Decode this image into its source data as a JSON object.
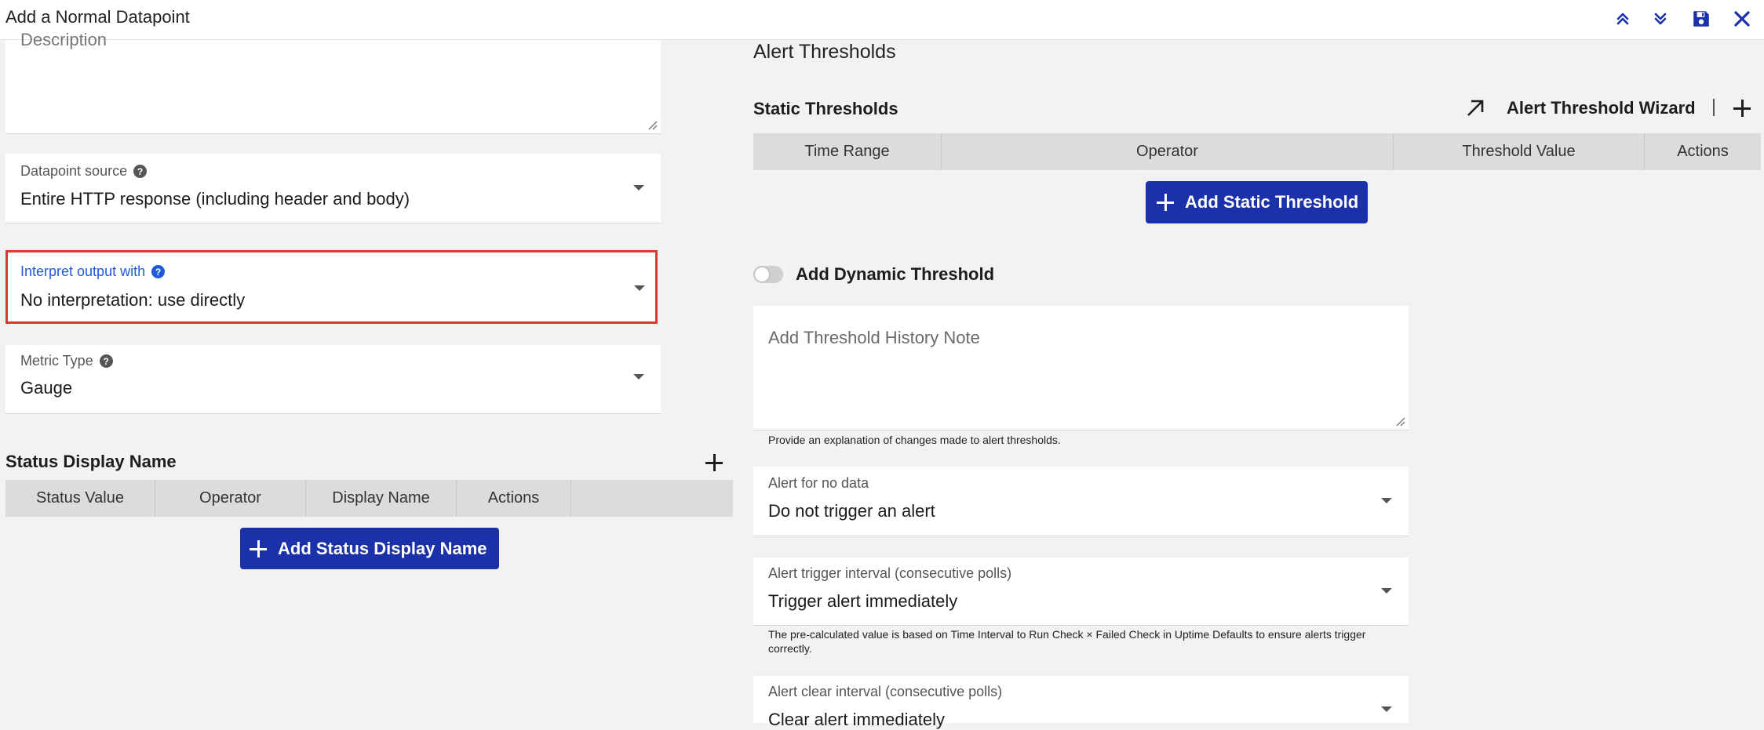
{
  "header": {
    "title": "Add a Normal Datapoint"
  },
  "left": {
    "description": {
      "placeholder": "Description"
    },
    "datapoint_source": {
      "label": "Datapoint source",
      "value": "Entire HTTP response (including header and body)"
    },
    "interpret_output": {
      "label": "Interpret output with",
      "value": "No interpretation: use directly"
    },
    "metric_type": {
      "label": "Metric Type",
      "value": "Gauge"
    },
    "status_display": {
      "title": "Status Display Name",
      "columns": [
        "Status Value",
        "Operator",
        "Display Name",
        "Actions"
      ],
      "add_label": "Add Status Display Name"
    }
  },
  "right": {
    "alert_thresholds_title": "Alert Thresholds",
    "static": {
      "title": "Static Thresholds",
      "wizard_label": "Alert Threshold Wizard",
      "columns": [
        "Time Range",
        "Operator",
        "Threshold Value",
        "Actions"
      ],
      "add_label": "Add Static Threshold"
    },
    "dynamic_label": "Add Dynamic Threshold",
    "history_note": {
      "placeholder": "Add Threshold History Note",
      "helper": "Provide an explanation of changes made to alert thresholds."
    },
    "no_data": {
      "label": "Alert for no data",
      "value": "Do not trigger an alert"
    },
    "trigger_interval": {
      "label": "Alert trigger interval (consecutive polls)",
      "value": "Trigger alert immediately",
      "helper": "The pre-calculated value is based on Time Interval to Run Check × Failed Check in Uptime Defaults to ensure alerts trigger correctly."
    },
    "clear_interval": {
      "label": "Alert clear interval (consecutive polls)",
      "value": "Clear alert immediately"
    }
  },
  "colors": {
    "primary": "#1a31a9",
    "highlight_border": "#d93a32",
    "link_blue": "#1f5bd8",
    "table_header": "#dcdcdf"
  }
}
